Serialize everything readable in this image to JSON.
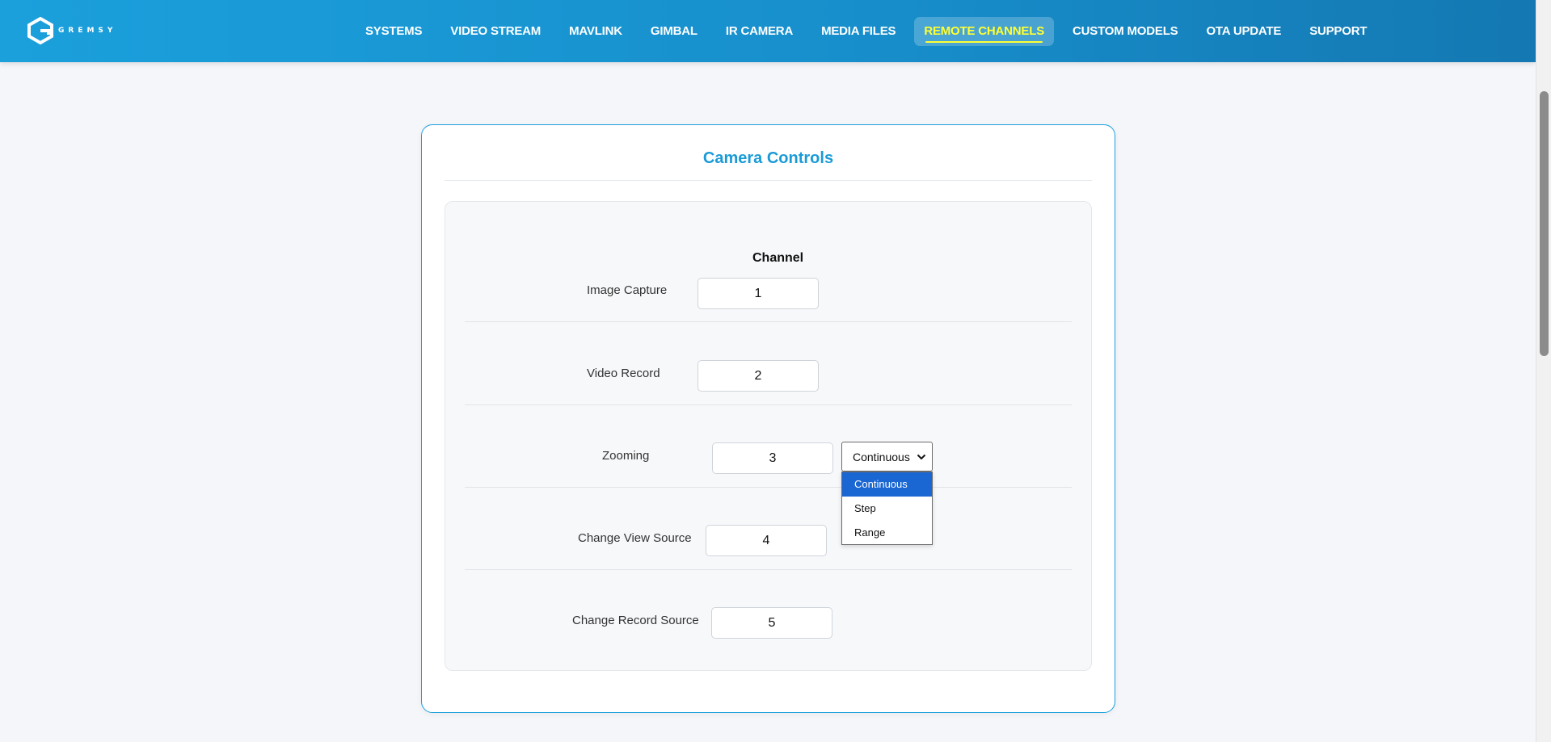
{
  "brand": {
    "logo_text": "GREMSY"
  },
  "nav": {
    "items": [
      {
        "label": "SYSTEMS"
      },
      {
        "label": "VIDEO STREAM"
      },
      {
        "label": "MAVLINK"
      },
      {
        "label": "GIMBAL"
      },
      {
        "label": "IR CAMERA"
      },
      {
        "label": "MEDIA FILES"
      },
      {
        "label": "REMOTE CHANNELS"
      },
      {
        "label": "CUSTOM MODELS"
      },
      {
        "label": "OTA UPDATE"
      },
      {
        "label": "SUPPORT"
      }
    ],
    "active_index": 6,
    "active_color": "#ffff33",
    "bar_color": "#1ba0dc"
  },
  "card": {
    "title": "Camera Controls",
    "column_header": "Channel",
    "title_color": "#1a9bd7"
  },
  "rows": [
    {
      "label": "Image Capture",
      "channel": "1"
    },
    {
      "label": "Video Record",
      "channel": "2"
    },
    {
      "label": "Zooming",
      "channel": "3"
    },
    {
      "label": "Change View Source",
      "channel": "4"
    },
    {
      "label": "Change Record Source",
      "channel": "5"
    }
  ],
  "zoom_mode": {
    "selected": "Continuous",
    "options": [
      "Continuous",
      "Step",
      "Range"
    ],
    "highlight_color": "#1a66d2"
  }
}
